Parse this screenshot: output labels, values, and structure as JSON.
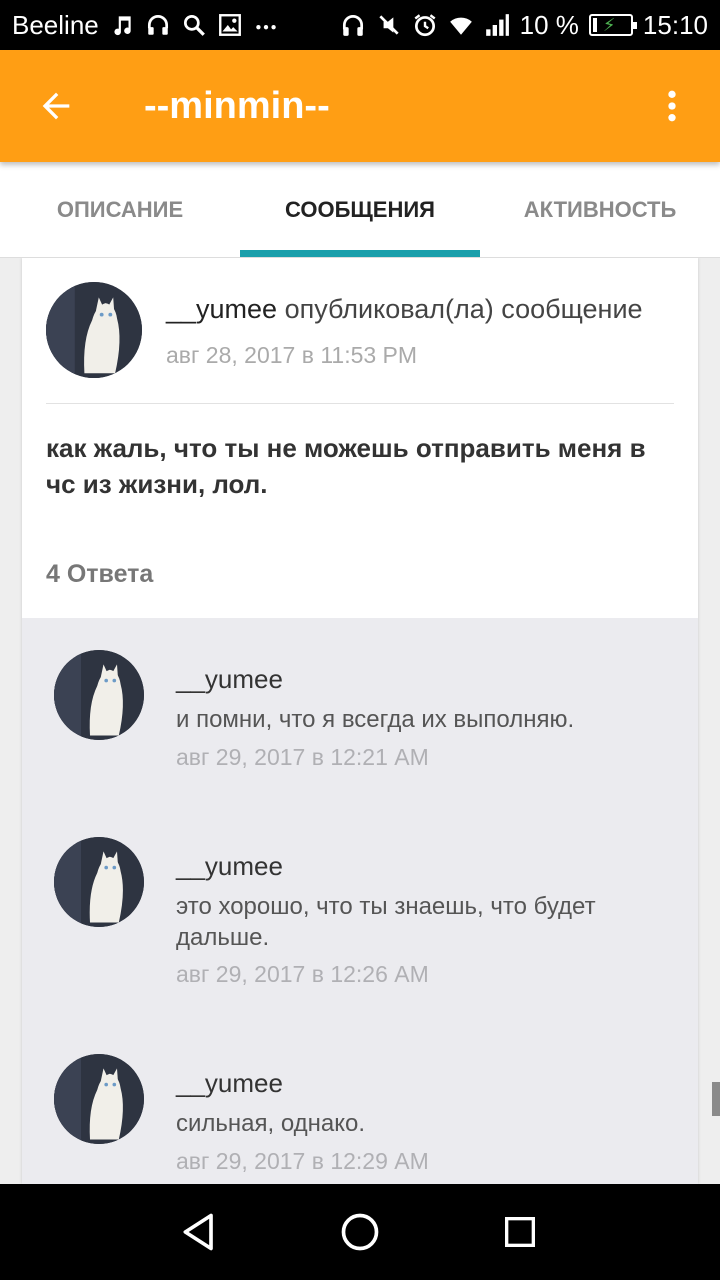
{
  "status_bar": {
    "carrier": "Beeline",
    "battery_percent": "10 %",
    "battery_level": 0.1,
    "time": "15:10",
    "left_icons": [
      "music-note-icon",
      "headset-icon",
      "search-icon",
      "image-icon",
      "more-dots-icon"
    ],
    "right_icons": [
      "headphones-icon",
      "mute-icon",
      "alarm-icon",
      "wifi-icon",
      "signal-icon",
      "battery-icon"
    ]
  },
  "app_bar": {
    "title": "--minmin--",
    "back_icon": "arrow-back-icon",
    "menu_icon": "more-vert-icon"
  },
  "tabs": [
    {
      "label": "ОПИСАНИЕ",
      "active": false
    },
    {
      "label": "СООБЩЕНИЯ",
      "active": true
    },
    {
      "label": "АКТИВНОСТЬ",
      "active": false
    }
  ],
  "post": {
    "author": "__yumee",
    "action": " опубликовал(ла) сообщение",
    "date": "авг 28, 2017 в 11:53 PM",
    "text": "как жаль, что ты не можешь отправить меня в чс из жизни, лол.",
    "replies_count_label": "4 Ответа"
  },
  "replies": [
    {
      "author": "__yumee",
      "text": "и помни, что я всегда их выполняю.",
      "date": "авг 29, 2017 в 12:21 AM"
    },
    {
      "author": "__yumee",
      "text": "это хорошо, что ты знаешь, что будет дальше.",
      "date": "авг 29, 2017 в 12:26 AM"
    },
    {
      "author": "__yumee",
      "text": "сильная, однако.",
      "date": "авг 29, 2017 в 12:29 AM"
    }
  ],
  "nav_bar": {
    "icons": [
      "nav-back-icon",
      "nav-home-icon",
      "nav-recents-icon"
    ]
  },
  "colors": {
    "app_bar": "#ff9e14",
    "tab_indicator": "#1a9fab",
    "replies_background": "#ebebef"
  }
}
